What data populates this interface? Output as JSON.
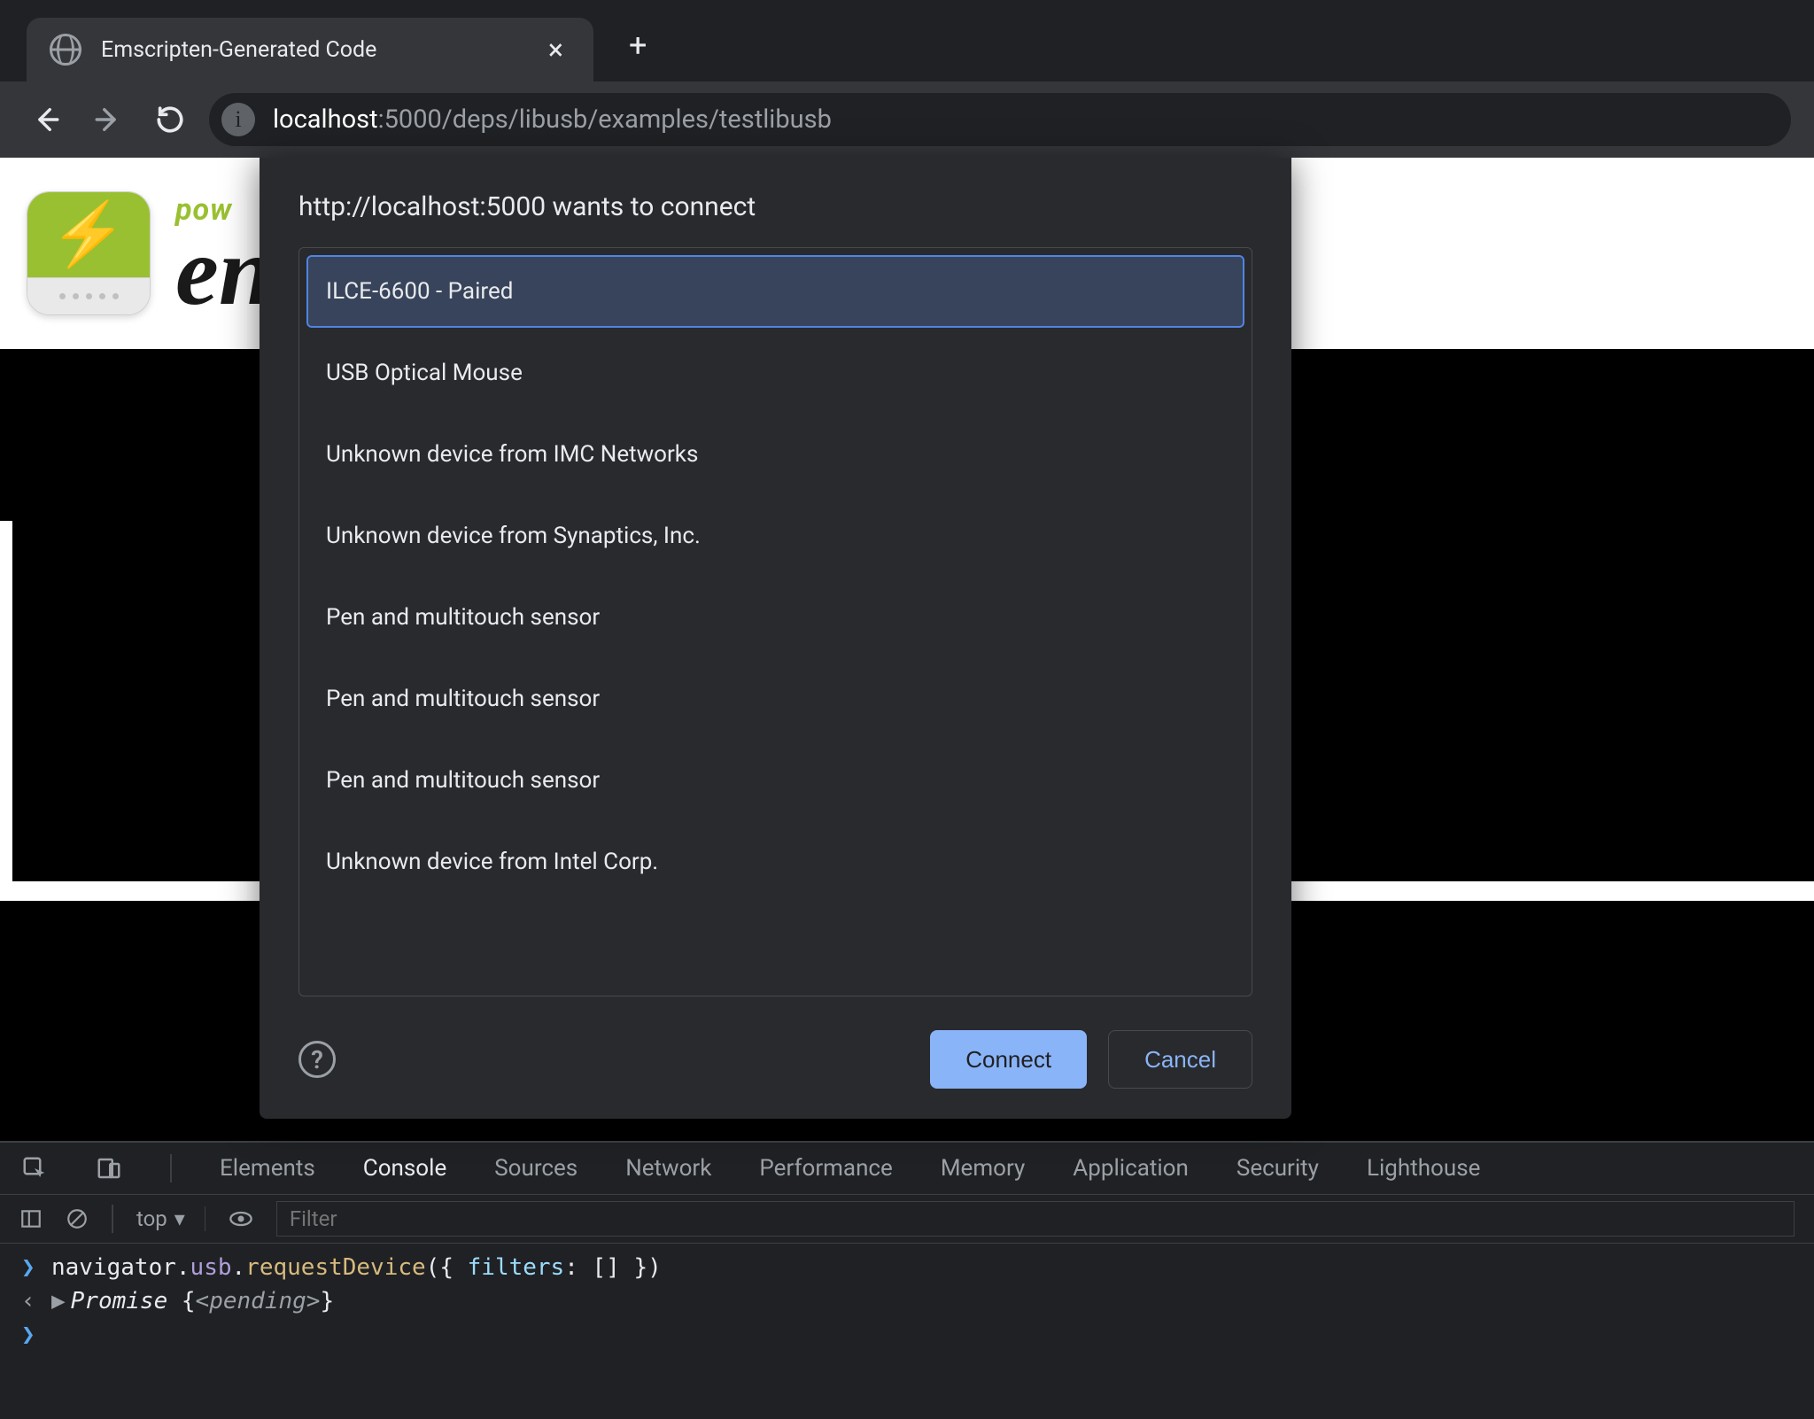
{
  "browser": {
    "tab_title": "Emscripten-Generated Code",
    "url_host": "localhost",
    "url_path": ":5000/deps/libusb/examples/testlibusb"
  },
  "page": {
    "logo_sup": "pow",
    "logo_main": "en"
  },
  "usb_dialog": {
    "prompt": "http://localhost:5000 wants to connect",
    "devices": [
      "ILCE-6600 - Paired",
      "USB Optical Mouse",
      "Unknown device from IMC Networks",
      "Unknown device from Synaptics, Inc.",
      "Pen and multitouch sensor",
      "Pen and multitouch sensor",
      "Pen and multitouch sensor",
      "Unknown device from Intel Corp."
    ],
    "selected_index": 0,
    "connect_label": "Connect",
    "cancel_label": "Cancel"
  },
  "devtools": {
    "tabs": [
      "Elements",
      "Console",
      "Sources",
      "Network",
      "Performance",
      "Memory",
      "Application",
      "Security",
      "Lighthouse"
    ],
    "context_label": "top",
    "filter_placeholder": "Filter",
    "console": {
      "input": "navigator.usb.requestDevice({ filters: [] })",
      "output_prefix": "Promise",
      "output_state": "<pending>"
    }
  }
}
